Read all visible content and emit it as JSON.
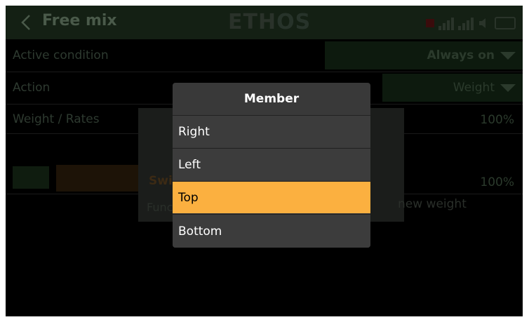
{
  "header": {
    "title": "Free mix",
    "logo_main": "ETH",
    "logo_accent": "OS"
  },
  "rows": [
    {
      "label": "Active condition",
      "value": "Always on"
    },
    {
      "label": "Action",
      "value": "Weight"
    },
    {
      "label": "Weight / Rates",
      "value": "100%"
    },
    {
      "label": "",
      "value": "100%"
    }
  ],
  "background_dialog": {
    "title_fragment": "Swi",
    "text_fragment": "Func",
    "right_text": "new weight"
  },
  "popup": {
    "title": "Member",
    "options": [
      "Right",
      "Left",
      "Top",
      "Bottom"
    ],
    "selected": "Top",
    "selected_color": "#fbb040"
  },
  "colors": {
    "header_bg": "#142014",
    "popup_bg": "#393939"
  }
}
